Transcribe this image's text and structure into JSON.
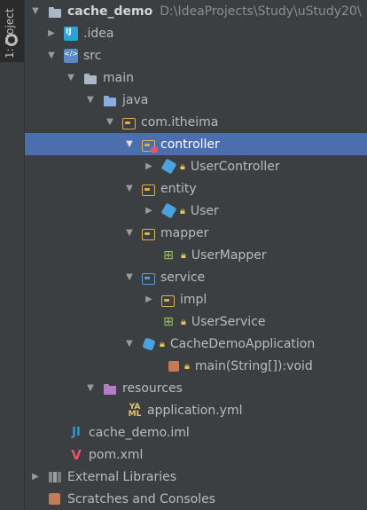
{
  "side_tab": {
    "label": "1: Project",
    "icon": "project-icon"
  },
  "tree": [
    {
      "key": "cache_demo",
      "label": "cache_demo",
      "path": "D:\\IdeaProjects\\Study\\uStudy20\\"
    },
    {
      "key": "idea",
      "label": ".idea"
    },
    {
      "key": "src",
      "label": "src"
    },
    {
      "key": "main",
      "label": "main"
    },
    {
      "key": "java",
      "label": "java"
    },
    {
      "key": "com_itheima",
      "label": "com.itheima"
    },
    {
      "key": "controller",
      "label": "controller"
    },
    {
      "key": "user_controller",
      "label": "UserController"
    },
    {
      "key": "entity",
      "label": "entity"
    },
    {
      "key": "user",
      "label": "User"
    },
    {
      "key": "mapper",
      "label": "mapper"
    },
    {
      "key": "user_mapper",
      "label": "UserMapper"
    },
    {
      "key": "service",
      "label": "service"
    },
    {
      "key": "impl",
      "label": "impl"
    },
    {
      "key": "user_service",
      "label": "UserService"
    },
    {
      "key": "cache_demo_app",
      "label": "CacheDemoApplication"
    },
    {
      "key": "main_method",
      "label": "main(String[]):void"
    },
    {
      "key": "resources",
      "label": "resources"
    },
    {
      "key": "application_yml",
      "label": "application.yml"
    },
    {
      "key": "cache_demo_iml",
      "label": "cache_demo.iml"
    },
    {
      "key": "pom_xml",
      "label": "pom.xml"
    },
    {
      "key": "external_libraries",
      "label": "External Libraries"
    },
    {
      "key": "scratches",
      "label": "Scratches and Consoles"
    }
  ],
  "colors": {
    "background": "#3c3f41",
    "selected": "#4b6eaf",
    "text": "#bbbbbb"
  }
}
